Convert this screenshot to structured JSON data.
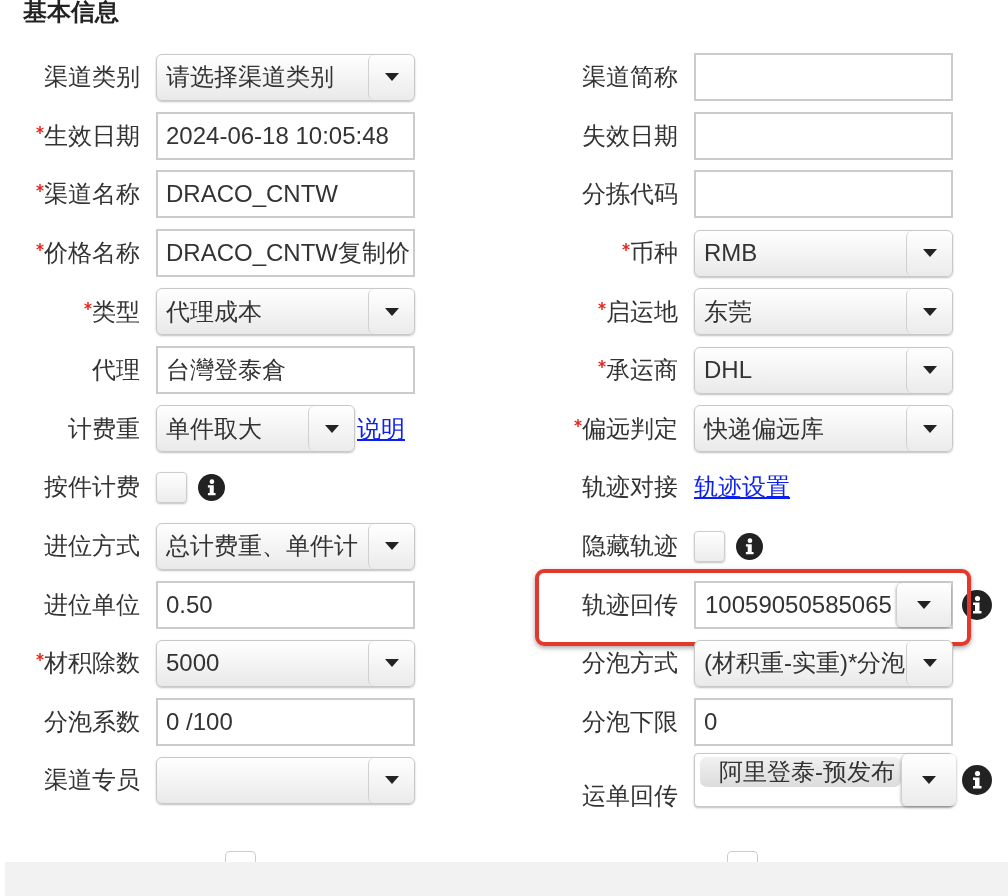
{
  "section": {
    "title": "基本信息"
  },
  "columns": [
    {
      "fields": [
        {
          "label": "渠道类别",
          "required": false,
          "kind": "select",
          "placeholder": "请选择渠道类别",
          "highlighted": false
        },
        {
          "label": "生效日期",
          "required": true,
          "kind": "input",
          "value": "2024-06-18 10:05:48",
          "highlighted": false
        },
        {
          "label": "渠道名称",
          "required": true,
          "kind": "input",
          "value": "DRACO_CNTW",
          "highlighted": false
        },
        {
          "label": "价格名称",
          "required": true,
          "kind": "input",
          "value": "DRACO_CNTW复制价",
          "highlighted": false
        },
        {
          "label": "类型",
          "required": true,
          "kind": "select",
          "value": "代理成本",
          "highlighted": false
        },
        {
          "label": "代理",
          "required": false,
          "kind": "input",
          "value": "台灣登泰倉",
          "highlighted": false
        },
        {
          "label": "计费重",
          "required": false,
          "kind": "select",
          "value": "单件取大",
          "link": "说明",
          "highlighted": false
        },
        {
          "label": "按件计费",
          "required": false,
          "kind": "checkbox",
          "checked": false,
          "info": true,
          "highlighted": false
        },
        {
          "label": "进位方式",
          "required": false,
          "kind": "select",
          "value": "总计费重、单件计",
          "highlighted": false
        },
        {
          "label": "进位单位",
          "required": false,
          "kind": "input",
          "value": "0.50",
          "highlighted": false
        },
        {
          "label": "材积除数",
          "required": true,
          "kind": "select",
          "value": "5000",
          "highlighted": false
        },
        {
          "label": "分泡系数",
          "required": false,
          "kind": "input",
          "value": "0 /100",
          "highlighted": false
        },
        {
          "label": "渠道专员",
          "required": false,
          "kind": "select",
          "highlighted": false
        }
      ]
    },
    {
      "fields": [
        {
          "label": "渠道简称",
          "required": false,
          "kind": "input",
          "highlighted": false
        },
        {
          "label": "失效日期",
          "required": false,
          "kind": "input",
          "highlighted": false
        },
        {
          "label": "分拣代码",
          "required": false,
          "kind": "input",
          "highlighted": false
        },
        {
          "label": "币种",
          "required": true,
          "kind": "select",
          "value": "RMB",
          "highlighted": false
        },
        {
          "label": "启运地",
          "required": true,
          "kind": "select",
          "value": "东莞",
          "highlighted": false
        },
        {
          "label": "承运商",
          "required": true,
          "kind": "select",
          "value": "DHL",
          "highlighted": false
        },
        {
          "label": "偏远判定",
          "required": true,
          "kind": "select",
          "value": "快递偏远库",
          "highlighted": false
        },
        {
          "label": "轨迹对接",
          "required": false,
          "kind": "link",
          "link": "轨迹设置",
          "highlighted": false
        },
        {
          "label": "隐藏轨迹",
          "required": false,
          "kind": "checkbox",
          "checked": false,
          "info": true,
          "highlighted": false
        },
        {
          "label": "轨迹回传",
          "required": false,
          "kind": "combo",
          "value": "10059050585065",
          "info": true,
          "highlighted": true
        },
        {
          "label": "分泡方式",
          "required": false,
          "kind": "select",
          "value": "(材积重-实重)*分泡",
          "highlighted": false
        },
        {
          "label": "分泡下限",
          "required": false,
          "kind": "input",
          "value": "0",
          "highlighted": false
        },
        {
          "label": "运单回传",
          "required": false,
          "kind": "multi",
          "tags": [
            "阿里登泰-预发布"
          ],
          "info": true,
          "highlighted": false
        }
      ]
    }
  ],
  "bottom_checkboxes": [
    {
      "checked": false
    },
    {
      "checked": false
    }
  ]
}
